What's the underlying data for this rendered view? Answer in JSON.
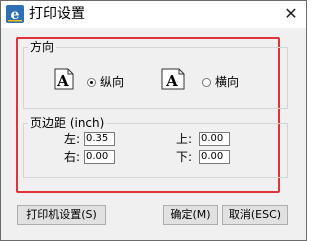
{
  "window": {
    "title": "打印设置",
    "close_glyph": "✕"
  },
  "orientation": {
    "group_label": "方向",
    "portrait_label": "纵向",
    "landscape_label": "横向",
    "selected": "portrait"
  },
  "margins": {
    "group_label": "页边距 (inch)",
    "left_label": "左:",
    "left_value": "0.35",
    "right_label": "右:",
    "right_value": "0.00",
    "top_label": "上:",
    "top_value": "0.00",
    "bottom_label": "下:",
    "bottom_value": "0.00"
  },
  "buttons": {
    "printer_settings": "打印机设置(S)",
    "ok": "确定(M)",
    "cancel": "取消(ESC)"
  },
  "colors": {
    "highlight_frame": "#e0333a",
    "app_icon": "#2e6fb5"
  }
}
